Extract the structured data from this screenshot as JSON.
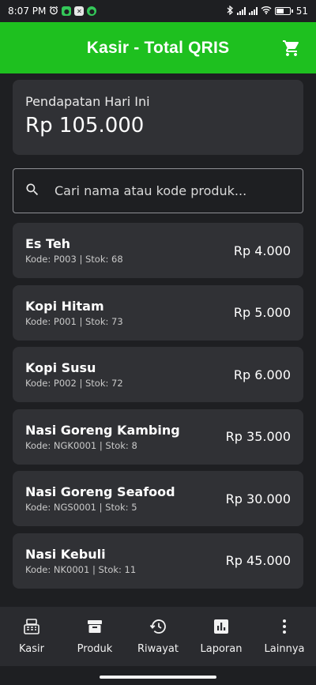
{
  "status_bar": {
    "time": "8:07 PM",
    "battery": "51"
  },
  "app_bar": {
    "title": "Kasir - Total QRIS",
    "cart_icon": "shopping-cart-icon"
  },
  "revenue": {
    "label": "Pendapatan Hari Ini",
    "value": "Rp 105.000"
  },
  "search": {
    "placeholder": "Cari nama atau kode produk...",
    "value": ""
  },
  "products": [
    {
      "name": "Es Teh",
      "meta": "Kode: P003 | Stok: 68",
      "price": "Rp 4.000"
    },
    {
      "name": "Kopi Hitam",
      "meta": "Kode: P001 | Stok: 73",
      "price": "Rp 5.000"
    },
    {
      "name": "Kopi Susu",
      "meta": "Kode: P002 | Stok: 72",
      "price": "Rp 6.000"
    },
    {
      "name": "Nasi Goreng Kambing",
      "meta": "Kode: NGK0001 | Stok: 8",
      "price": "Rp 35.000"
    },
    {
      "name": "Nasi Goreng Seafood",
      "meta": "Kode: NGS0001 | Stok: 5",
      "price": "Rp 30.000"
    },
    {
      "name": "Nasi Kebuli",
      "meta": "Kode: NK0001 | Stok: 11",
      "price": "Rp 45.000"
    }
  ],
  "bottom_nav": [
    {
      "label": "Kasir",
      "icon": "cash-register-icon"
    },
    {
      "label": "Produk",
      "icon": "archive-box-icon"
    },
    {
      "label": "Riwayat",
      "icon": "history-icon"
    },
    {
      "label": "Laporan",
      "icon": "bar-chart-icon"
    },
    {
      "label": "Lainnya",
      "icon": "more-vertical-icon"
    }
  ],
  "colors": {
    "app_bar": "#1ec01f",
    "background": "#1e1f22",
    "card": "#303135",
    "nav": "#2a2b2f"
  }
}
